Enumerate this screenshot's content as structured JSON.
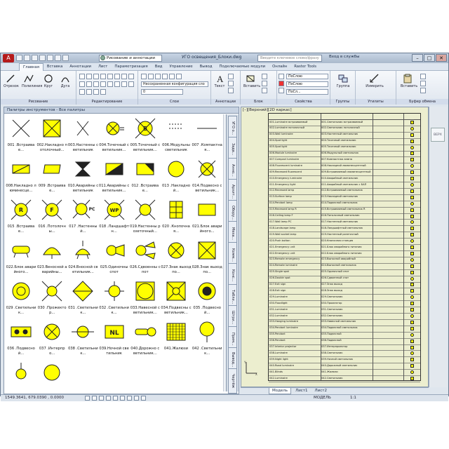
{
  "window": {
    "title": "УГО освещения_Блоки.dwg",
    "workspace": "Рисование и аннотации",
    "search_placeholder": "Введите ключевое слово/фразу",
    "login": "Вход в службы",
    "controls": [
      "–",
      "□",
      "✕"
    ]
  },
  "menu": {
    "tabs": [
      "Главная",
      "Вставка",
      "Аннотации",
      "Лист",
      "Параметризация",
      "Вид",
      "Управление",
      "Вывод",
      "Подключаемые модули",
      "Онлайн",
      "Raster Tools"
    ]
  },
  "ribbon": {
    "groups": {
      "draw": "Рисование",
      "modify": "Редактирование",
      "layers": "Слои",
      "annotation": "Аннотации",
      "block": "Блок",
      "properties": "Свойства",
      "groups": "Группы",
      "utilities": "Утилиты",
      "clipboard": "Буфер обмена"
    },
    "buttons": {
      "line": "Отрезок",
      "polyline": "Полилиния",
      "circle": "Круг",
      "arc": "Дуга",
      "text": "Текст",
      "insert": "Вставить",
      "group": "Группа",
      "measure": "Измерить",
      "paste": "Вставить"
    },
    "layer_combo": "Несохраненная конфигурация сло",
    "layer_value": "0",
    "prop_by_layer_1": "ПоСлою",
    "prop_by_layer_2": "ПоСлою",
    "prop_by_layer_3": "ПоСл..."
  },
  "palette": {
    "title": "Палитры инструментов - Все палитры",
    "side_tabs": [
      "УГО о...",
      "Задв...",
      "Анно...",
      "Архит...",
      "Обору...",
      "Меха...",
      "Комм...",
      "Конс...",
      "Табли...",
      "Штри...",
      "Прим...",
      "Вывод...",
      "Чертёж"
    ],
    "tools": [
      {
        "label": "001 .Встраивае...",
        "symbol": "x"
      },
      {
        "label": "002.Накладно потолочный...",
        "symbol": "box-x"
      },
      {
        "label": "003.Настенны светильник",
        "symbol": "x-thin"
      },
      {
        "label": "004.Точечный светильник...",
        "symbol": "circle-a"
      },
      {
        "label": "005.Точечный светильник...",
        "symbol": "circle-b"
      },
      {
        "label": "006.Модульны светильник",
        "symbol": "dashes"
      },
      {
        "label": "007 .Компактная...",
        "symbol": "line"
      },
      {
        "label": "008.Накладно люминесце...",
        "symbol": "box-diag"
      },
      {
        "label": "009 .Встраивае...",
        "symbol": "para"
      },
      {
        "label": "010.Аварийны светильник",
        "symbol": "hourglass"
      },
      {
        "label": "011.Аварийны светильник...",
        "symbol": "rect-split"
      },
      {
        "label": "012 .Встраивае...",
        "symbol": "rect-tri"
      },
      {
        "label": "013 .Накладной...",
        "symbol": "circle"
      },
      {
        "label": "014.Подвесно светильник...",
        "symbol": "circle-x"
      },
      {
        "label": "015 .Встраивае...",
        "symbol": "circle-r"
      },
      {
        "label": "016 .Потолочны...",
        "symbol": "circle-f"
      },
      {
        "label": "017 .Настенный...",
        "symbol": "circle-pc"
      },
      {
        "label": "018 .Ландшафтн...",
        "symbol": "circle-wp"
      },
      {
        "label": "019.Настенны розеточный...",
        "symbol": "circle-x2"
      },
      {
        "label": "020 .Кнопочная...",
        "symbol": "grid6"
      },
      {
        "label": "021.Блок аварийного...",
        "symbol": "rect"
      },
      {
        "label": "022.Блок аварийного...",
        "symbol": "lamp"
      },
      {
        "label": "023.Веносной аварийны...",
        "symbol": "lamp-dome"
      },
      {
        "label": "024.Вносной светильник...",
        "symbol": "lamp-hang"
      },
      {
        "label": "025.Одиночны спот",
        "symbol": "spot"
      },
      {
        "label": "026.Сдвоенны спот",
        "symbol": "spot-double"
      },
      {
        "label": "027.Знак выход по...",
        "symbol": "circle-x3"
      },
      {
        "label": "028.Знак выход по...",
        "symbol": "box-x2"
      },
      {
        "label": "029 .Светильник...",
        "symbol": "ring"
      },
      {
        "label": "030 .Прожектор...",
        "symbol": "circle-x4"
      },
      {
        "label": "031 .Светильник...",
        "symbol": "diamond"
      },
      {
        "label": "032 .Светильник...",
        "symbol": "circle-cross"
      },
      {
        "label": "033.Навесной светильник...",
        "symbol": "sq-circle"
      },
      {
        "label": "034.Подвесны светильник...",
        "symbol": "box-x3"
      },
      {
        "label": "035 .Подвесной...",
        "symbol": "ring-dot"
      },
      {
        "label": "036 .Подвесной...",
        "symbol": "pill"
      },
      {
        "label": "037 .Интерпро...",
        "symbol": "circle-star"
      },
      {
        "label": "038 .Светильник...",
        "symbol": "circle-dash"
      },
      {
        "label": "039.Ночной светильник",
        "symbol": "nl"
      },
      {
        "label": "040.Дорожно светильник...",
        "symbol": "torch"
      },
      {
        "label": "041.Жалюзи",
        "symbol": "grid-fine"
      },
      {
        "label": "042 .Светильник...",
        "symbol": "circle-tail"
      },
      {
        "label": "",
        "symbol": "circle-sm"
      },
      {
        "label": "",
        "symbol": "circle"
      }
    ]
  },
  "drawing": {
    "view_label": "[–][Верхний][2D каркас]",
    "table_rows": [
      [
        "001.Luminaire встраиваемый",
        "001.Светильник встраиваемый"
      ],
      [
        "002.Luminaire потолочный",
        "002.Светильник потолочный"
      ],
      [
        "003.Wall luminaire",
        "003.Настенный светильник"
      ],
      [
        "004.Spot light",
        "004.Точечный светильник"
      ],
      [
        "005.Spot light",
        "005.Точечный светильник"
      ],
      [
        "006.Module luminaire",
        "006.Модульный светильник"
      ],
      [
        "007.Compact luminaire",
        "007.Компактная лампа"
      ],
      [
        "008.Fluorescent luminaire",
        "008.Накладной люминесцентный"
      ],
      [
        "009.Recessed fluorescent",
        "009.Встраиваемый люминесцентный"
      ],
      [
        "010.Emergency luminaire",
        "010.Аварийный светильник"
      ],
      [
        "011.Emergency light",
        "011.Аварийный светильник с БАП"
      ],
      [
        "012.Recessed lamp",
        "012.Встраиваемый светильник"
      ],
      [
        "013.Surface lamp",
        "013.Накладной светильник"
      ],
      [
        "014.Pendant lamp",
        "014.Подвесной светильник"
      ],
      [
        "015.Recessed lamp R",
        "015.Встраиваемый светильник R"
      ],
      [
        "016.Ceiling lamp F",
        "016.Потолочный светильник"
      ],
      [
        "017.Wall lamp PC",
        "017.Настенный светильник"
      ],
      [
        "018.Landscape lamp",
        "018.Ландшафтный светильник"
      ],
      [
        "019.Wall socket lamp",
        "019.Настенный розеточный"
      ],
      [
        "020.Push button",
        "020.Кнопочная станция"
      ],
      [
        "021.Emergency unit",
        "021.Блок аварийного питания"
      ],
      [
        "022.Emergency unit",
        "022.Блок аварийного питания"
      ],
      [
        "023.Remote emergency",
        "023.Выносной аварийный"
      ],
      [
        "024.Remote luminaire",
        "024.Выносной светильник"
      ],
      [
        "025.Single spot",
        "025.Одиночный спот"
      ],
      [
        "026.Double spot",
        "026.Сдвоенный спот"
      ],
      [
        "027.Exit sign",
        "027.Знак выход"
      ],
      [
        "028.Exit sign",
        "028.Знак выход"
      ],
      [
        "029.Luminaire",
        "029.Светильник"
      ],
      [
        "030.Floodlight",
        "030.Прожектор"
      ],
      [
        "031.Luminaire",
        "031.Светильник"
      ],
      [
        "032.Luminaire",
        "032.Светильник"
      ],
      [
        "033.Hanging luminaire",
        "033.Навесной светильник"
      ],
      [
        "034.Pendant luminaire",
        "034.Подвесной светильник"
      ],
      [
        "035.Pendant",
        "035.Подвесной"
      ],
      [
        "036.Pendant",
        "036.Подвесной"
      ],
      [
        "037.Interior projector",
        "037.Интерпроектор"
      ],
      [
        "038.Luminaire",
        "038.Светильник"
      ],
      [
        "039.Night light",
        "039.Ночной светильник"
      ],
      [
        "040.Road luminaire",
        "040.Дорожный светильник"
      ],
      [
        "041.Blinds",
        "041.Жалюзи"
      ],
      [
        "042.Luminaire",
        "042.Светильник"
      ]
    ],
    "viewcube_label": "ВЕРХ"
  },
  "layout_tabs": [
    "Модель",
    "Лист1",
    "Лист2"
  ],
  "status": {
    "coords": "1549.3641, 679.0390 , 0.0000",
    "model": "МОДЕЛЬ",
    "scale": "1:1"
  }
}
